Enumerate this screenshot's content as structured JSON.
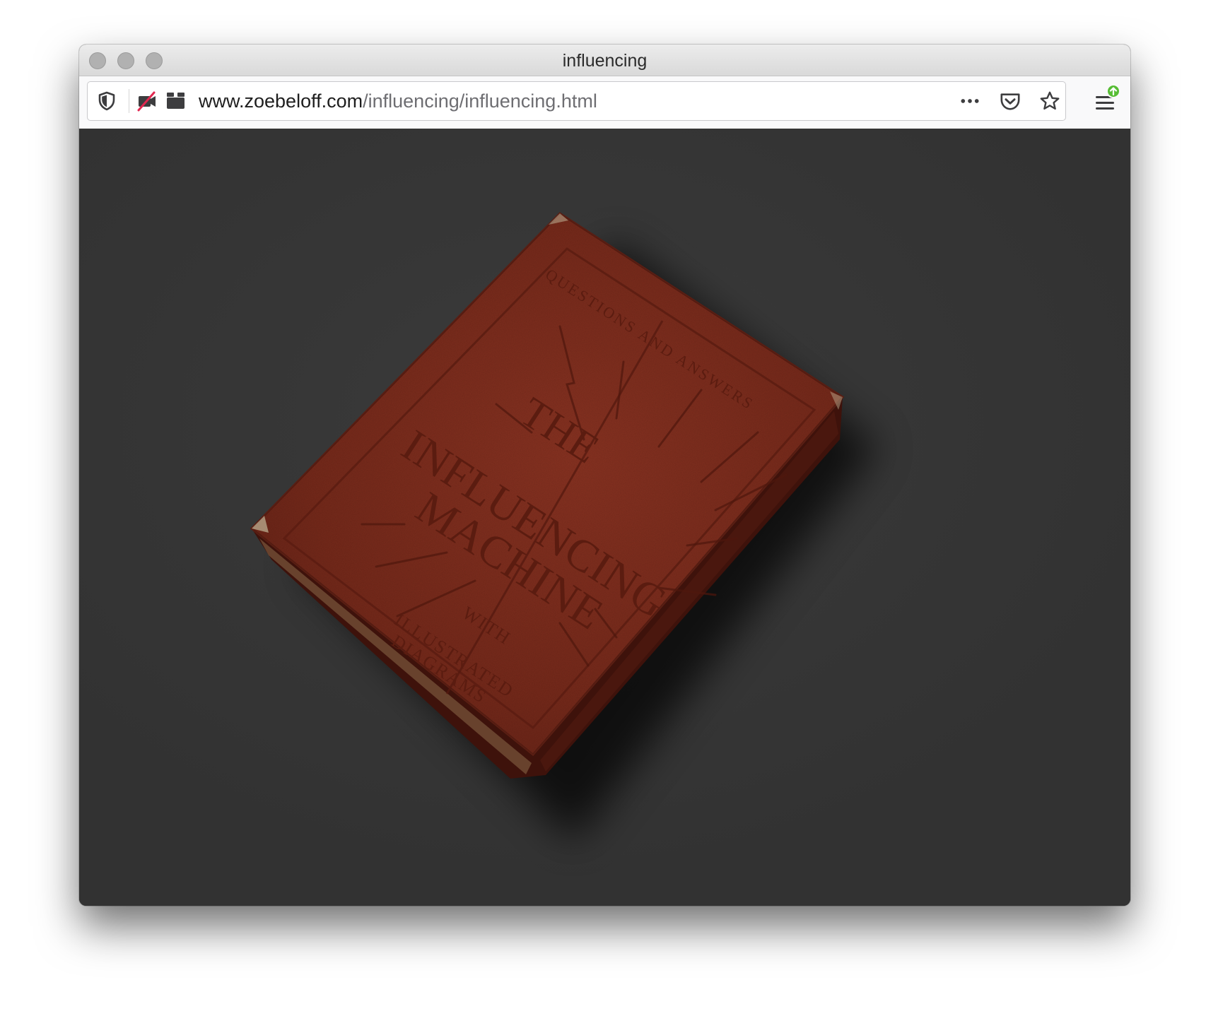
{
  "window": {
    "title": "influencing"
  },
  "urlbar": {
    "url_host": "www.zoebeloff.com",
    "url_path": "/influencing/influencing.html"
  },
  "icons": {
    "shield": "tracking-protection-shield-icon",
    "camera_blocked": "camera-blocked-icon",
    "permissions": "permissions-icon",
    "more": "page-actions-more-icon",
    "pocket": "pocket-icon",
    "bookmark": "bookmark-star-icon",
    "menu": "hamburger-menu-icon",
    "update": "update-available-icon"
  },
  "book": {
    "top_text": "QUESTIONS AND ANSWERS",
    "title_line1": "THE",
    "title_line2": "INFLUENCING",
    "title_line3": "MACHINE",
    "sub_line1": "WITH",
    "sub_line2": "ILLUSTRATED",
    "sub_line3": "DIAGRAMS"
  },
  "colors": {
    "page_background": "#333333",
    "book_cover": "#7a2a1c",
    "update_badge": "#57bd35"
  }
}
